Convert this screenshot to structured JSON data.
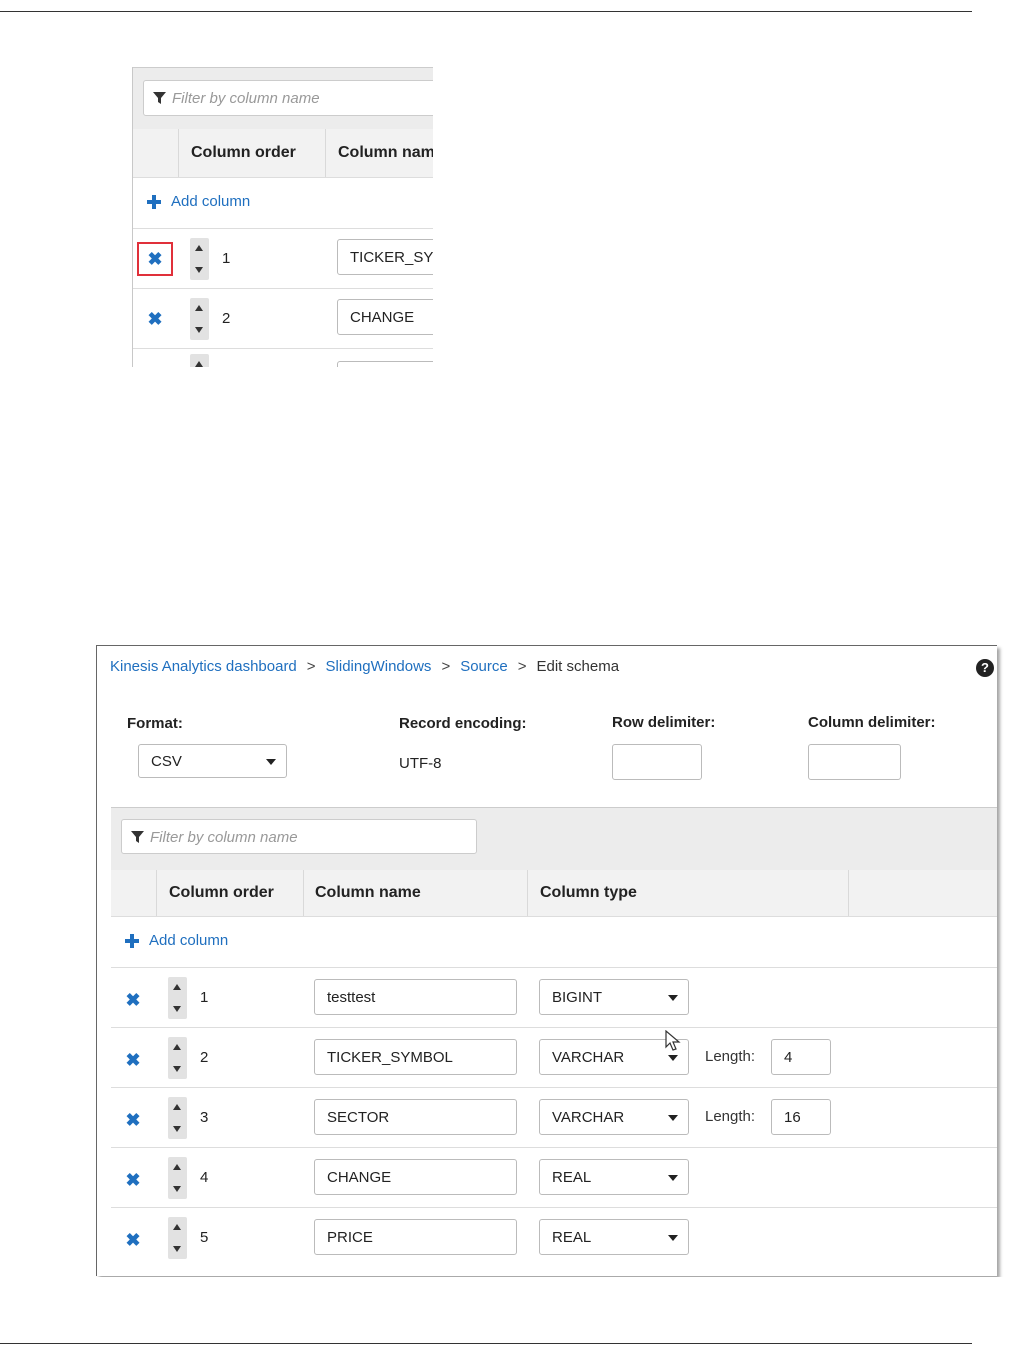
{
  "crop": {
    "filter_placeholder": "Filter by column name",
    "headers": [
      "Column order",
      "Column nam"
    ],
    "add_column": "Add column",
    "rows": [
      {
        "order": "1",
        "name": "TICKER_SY"
      },
      {
        "order": "2",
        "name": "CHANGE"
      }
    ]
  },
  "editor": {
    "breadcrumb": [
      "Kinesis Analytics dashboard",
      "SlidingWindows",
      "Source",
      "Edit schema"
    ],
    "breadcrumb_sep": ">",
    "help": "?",
    "format_label": "Format:",
    "format_value": "CSV",
    "encoding_label": "Record encoding:",
    "encoding_value": "UTF-8",
    "row_delim_label": "Row delimiter:",
    "row_delim_value": "",
    "col_delim_label": "Column delimiter:",
    "col_delim_value": "",
    "filter_placeholder": "Filter by column name",
    "headers": [
      "Column order",
      "Column name",
      "Column type"
    ],
    "add_column": "Add column",
    "length_label": "Length:",
    "rows": [
      {
        "order": "1",
        "name": "testtest",
        "type": "BIGINT",
        "length": ""
      },
      {
        "order": "2",
        "name": "TICKER_SYMBOL",
        "type": "VARCHAR",
        "length": "4"
      },
      {
        "order": "3",
        "name": "SECTOR",
        "type": "VARCHAR",
        "length": "16"
      },
      {
        "order": "4",
        "name": "CHANGE",
        "type": "REAL",
        "length": ""
      },
      {
        "order": "5",
        "name": "PRICE",
        "type": "REAL",
        "length": ""
      }
    ]
  }
}
